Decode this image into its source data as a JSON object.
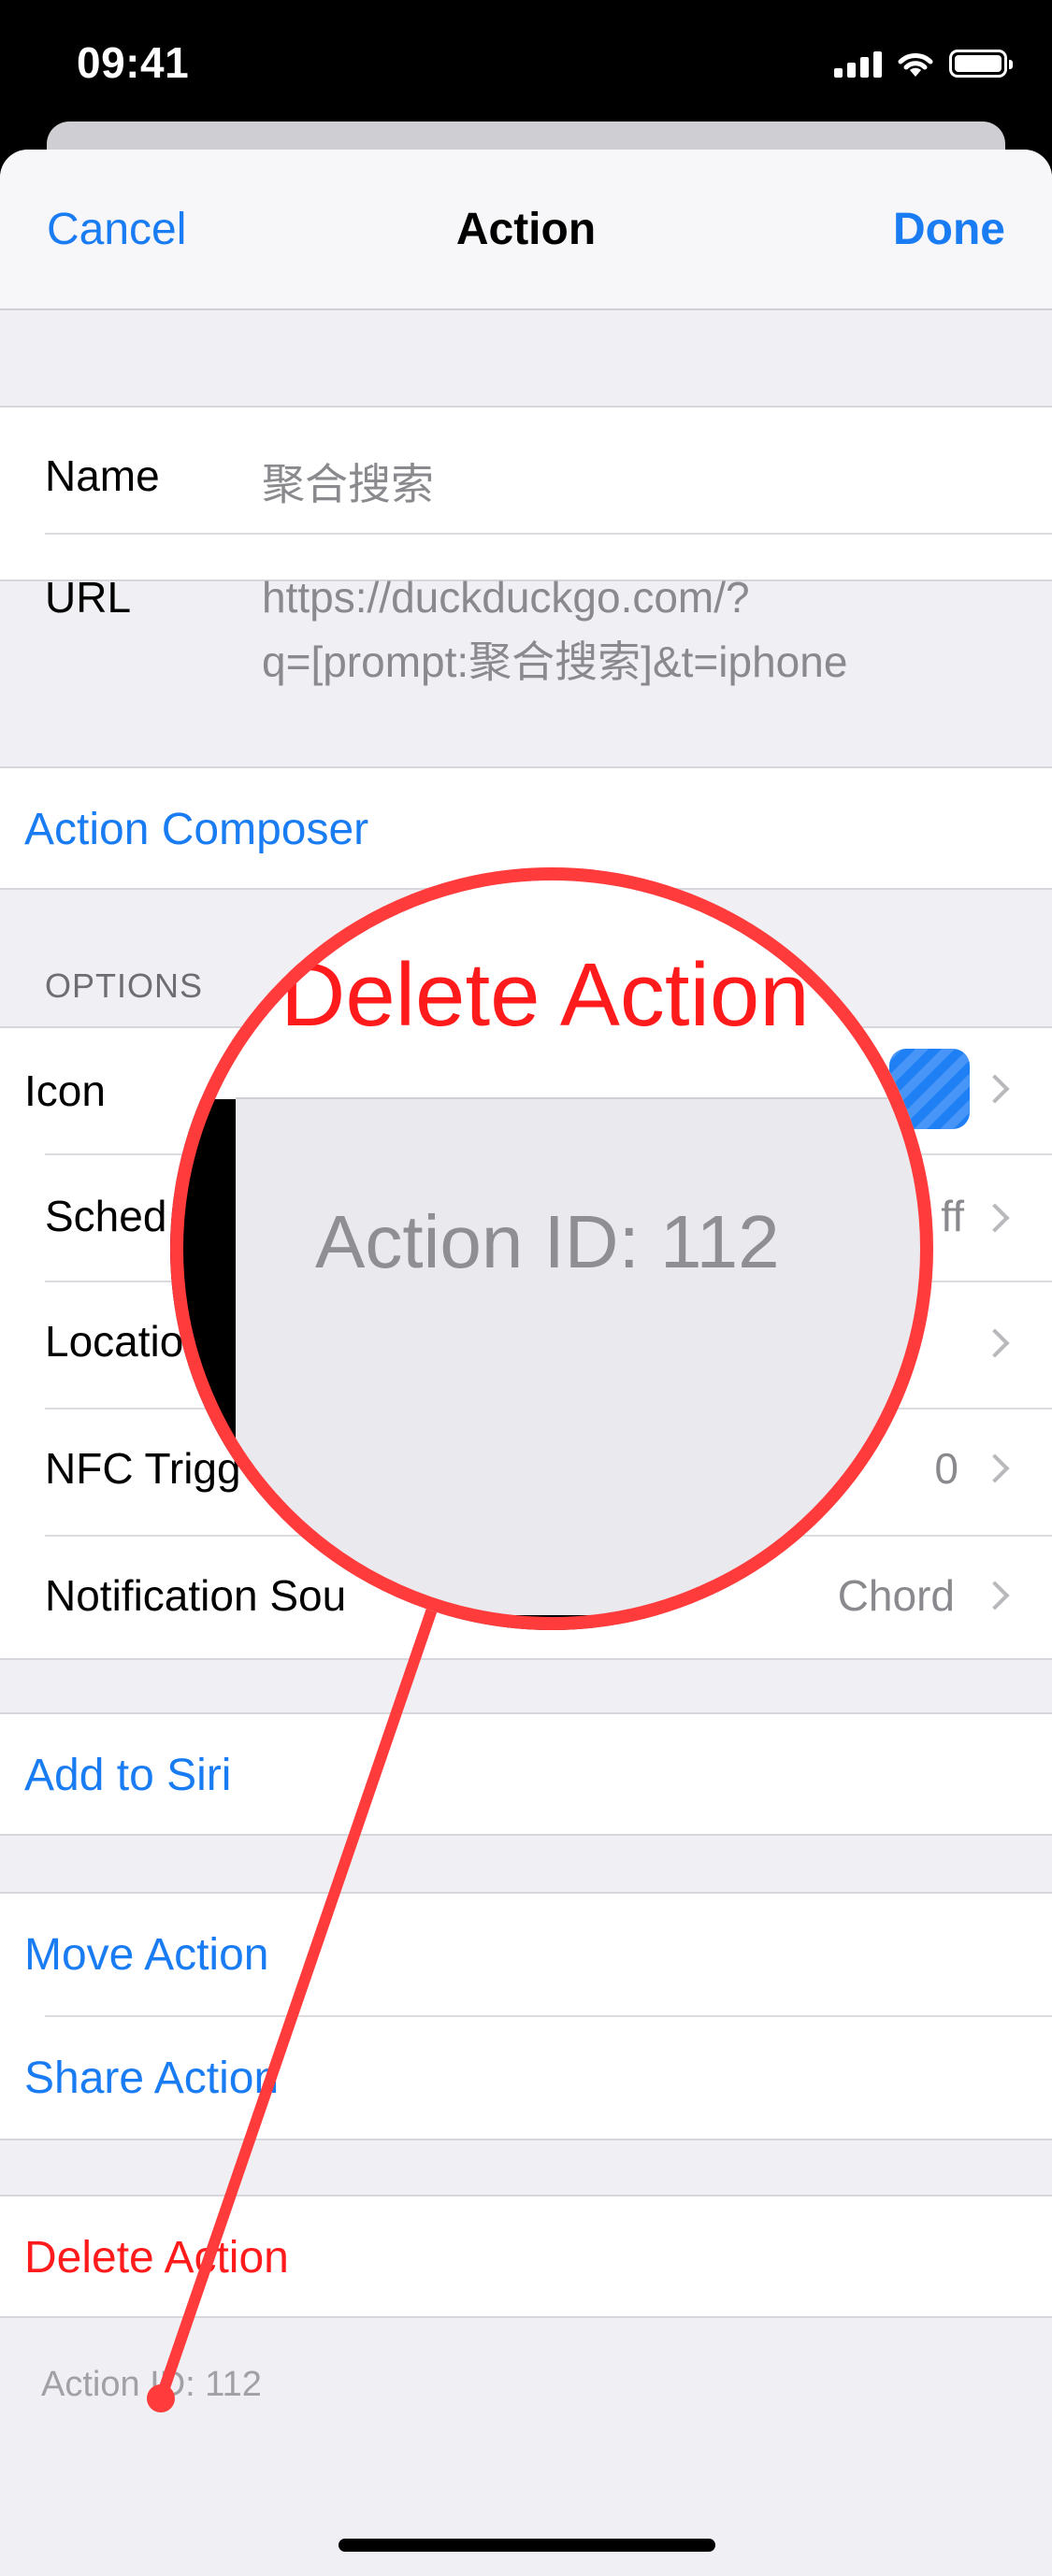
{
  "status_bar": {
    "time": "09:41"
  },
  "nav": {
    "cancel": "Cancel",
    "title": "Action",
    "done": "Done"
  },
  "fields": {
    "name_label": "Name",
    "name_value": "聚合搜索",
    "url_label": "URL",
    "url_line1": "https://duckduckgo.com/?",
    "url_line2": "q=[prompt:聚合搜索]&t=iphone"
  },
  "composer": "Action Composer",
  "options": {
    "header": "OPTIONS",
    "icon_label": "Icon",
    "schedule_label": "Sched",
    "schedule_value": "ff",
    "location_label": "Locatio",
    "nfc_label": "NFC Trigg",
    "nfc_value": "0",
    "notification_label": "Notification Sou",
    "notification_value": "Chord"
  },
  "siri": "Add to Siri",
  "manage": {
    "move": "Move Action",
    "share": "Share Action"
  },
  "delete": "Delete Action",
  "footer": "Action ID: 112",
  "magnifier": {
    "title": "Delete Action",
    "id": "Action ID: 112"
  },
  "colors": {
    "accent": "#1a7cf2",
    "destructive": "#ff1b1b",
    "highlight_ring": "#ff3b3b"
  }
}
